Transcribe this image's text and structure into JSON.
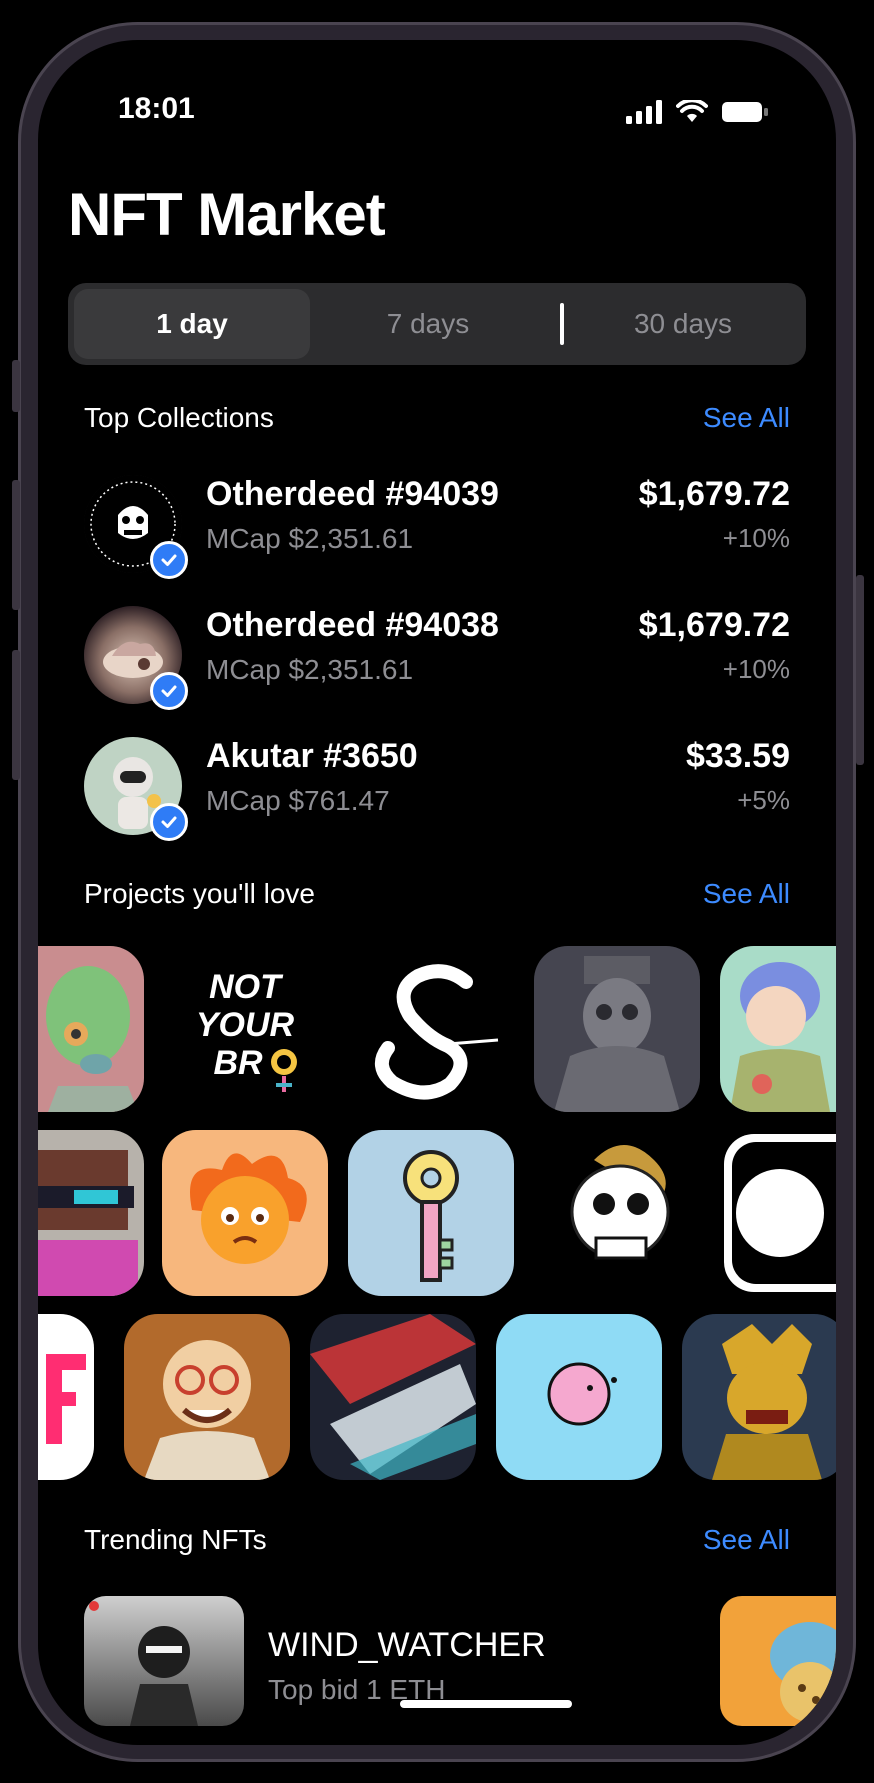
{
  "status_bar": {
    "time": "18:01"
  },
  "page_title": "NFT Market",
  "segments": [
    "1 day",
    "7 days",
    "30 days"
  ],
  "top_collections": {
    "title": "Top Collections",
    "see_all": "See All",
    "items": [
      {
        "name": "Otherdeed #94039",
        "mcap": "MCap $2,351.61",
        "price": "$1,679.72",
        "change": "+10%"
      },
      {
        "name": "Otherdeed #94038",
        "mcap": "MCap $2,351.61",
        "price": "$1,679.72",
        "change": "+10%"
      },
      {
        "name": "Akutar #3650",
        "mcap": "MCap $761.47",
        "price": "$33.59",
        "change": "+5%"
      }
    ]
  },
  "projects": {
    "title": "Projects you'll love",
    "see_all": "See All",
    "not_your_bro": "NOT YOUR BRO"
  },
  "trending": {
    "title": "Trending NFTs",
    "see_all": "See All",
    "items": [
      {
        "name": "WIND_WATCHER",
        "bid": "Top bid 1 ETH"
      }
    ]
  },
  "colors": {
    "accent": "#3d8bff",
    "verified": "#2f7cf6"
  }
}
